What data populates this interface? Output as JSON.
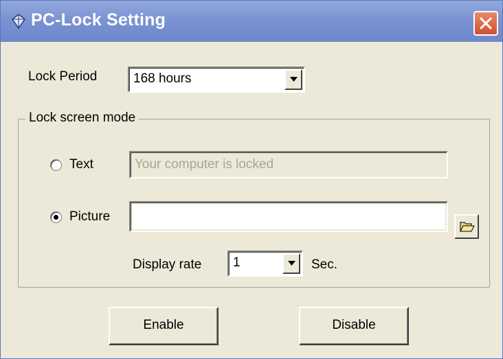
{
  "window": {
    "title": "PC-Lock Setting",
    "icon": "padlock-icon",
    "close_icon": "close-icon"
  },
  "lock_period": {
    "label": "Lock Period",
    "selected": "168 hours"
  },
  "lock_screen_mode": {
    "legend": "Lock screen mode",
    "text_option": {
      "label": "Text",
      "selected": false,
      "placeholder": "Your computer is locked",
      "enabled": false
    },
    "picture_option": {
      "label": "Picture",
      "selected": true,
      "value": "",
      "enabled": true,
      "browse_icon": "folder-open-icon"
    },
    "display_rate": {
      "label": "Display rate",
      "selected": "1",
      "unit": "Sec."
    }
  },
  "buttons": {
    "enable_label": "Enable",
    "disable_label": "Disable"
  },
  "colors": {
    "titlebar": "#7b93d2",
    "face": "#ece9d8",
    "close": "#cf5032"
  }
}
